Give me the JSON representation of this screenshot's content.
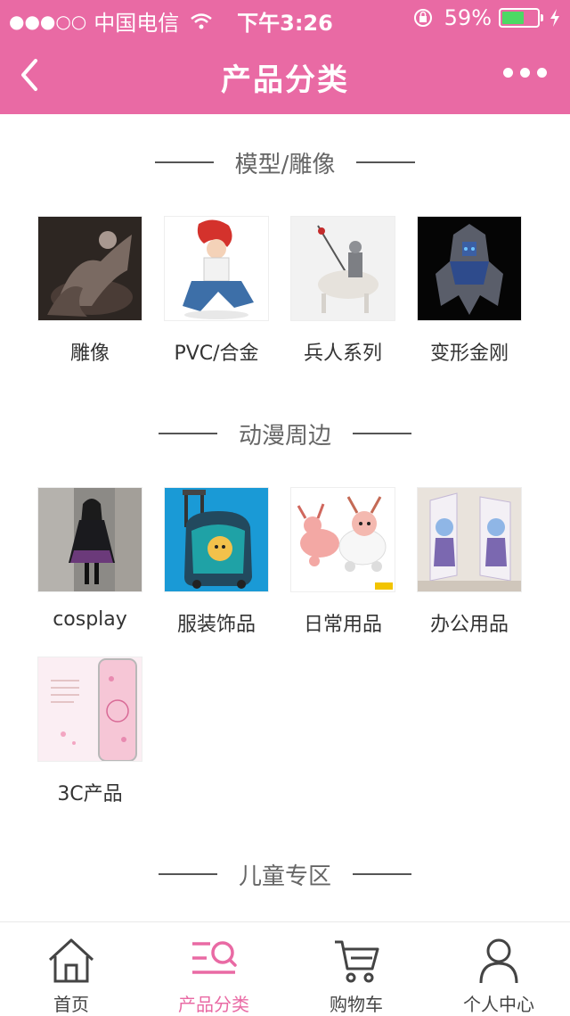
{
  "status_bar": {
    "signal": "●●●○○",
    "carrier": "中国电信",
    "time": "下午3:26",
    "battery": "59%"
  },
  "nav": {
    "title": "产品分类"
  },
  "sections": [
    {
      "title": "模型/雕像",
      "items": [
        {
          "label": "雕像"
        },
        {
          "label": "PVC/合金"
        },
        {
          "label": "兵人系列"
        },
        {
          "label": "变形金刚"
        }
      ]
    },
    {
      "title": "动漫周边",
      "items": [
        {
          "label": "cosplay"
        },
        {
          "label": "服装饰品"
        },
        {
          "label": "日常用品"
        },
        {
          "label": "办公用品"
        },
        {
          "label": "3C产品"
        }
      ]
    },
    {
      "title": "儿童专区",
      "items": []
    }
  ],
  "tabbar": {
    "items": [
      {
        "label": "首页",
        "icon": "home-icon"
      },
      {
        "label": "产品分类",
        "icon": "category-icon"
      },
      {
        "label": "购物车",
        "icon": "cart-icon"
      },
      {
        "label": "个人中心",
        "icon": "profile-icon"
      }
    ],
    "active_index": 1
  },
  "colors": {
    "brand": "#e96aa4",
    "battery": "#4cd964"
  }
}
